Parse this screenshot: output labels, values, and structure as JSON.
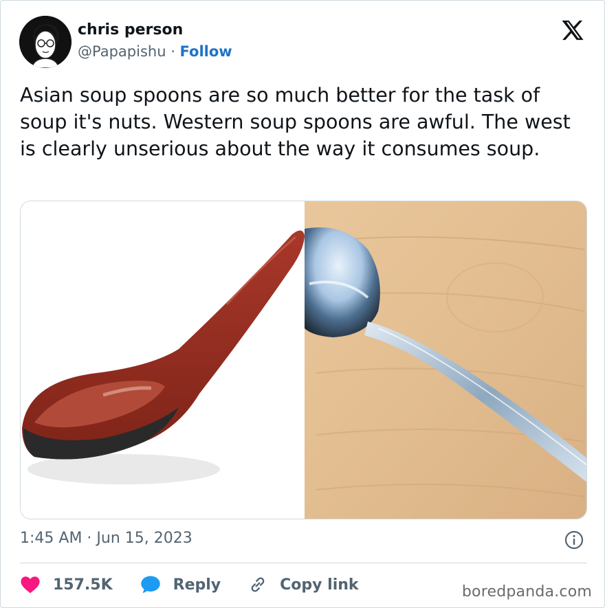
{
  "author": {
    "display_name": "chris person",
    "handle": "@Papapishu",
    "separator": " · ",
    "follow_label": "Follow"
  },
  "tweet": {
    "text": "Asian soup spoons are so much better for the task of soup it's nuts. Western soup spoons are awful. The west is clearly unserious about the way it consumes soup.",
    "timestamp": "1:45 AM · Jun 15, 2023"
  },
  "actions": {
    "likes_count": "157.5K",
    "reply_label": "Reply",
    "copy_link_label": "Copy link"
  },
  "media": {
    "left_image": "asian-soup-spoon",
    "right_image": "western-soup-spoon-on-wood"
  },
  "watermark": "boredpanda.com",
  "colors": {
    "follow": "#1d73c9",
    "heart": "#f91880",
    "reply_bubble": "#1d9bf0",
    "muted_text": "#536471"
  }
}
